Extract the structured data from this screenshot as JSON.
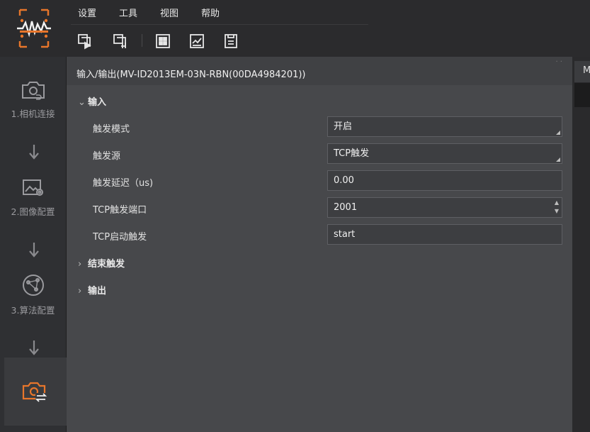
{
  "menu": [
    "设置",
    "工具",
    "视图",
    "帮助"
  ],
  "toolbar": {
    "icons": [
      "run-single-icon",
      "run-continuous-icon",
      "layout-grid-icon",
      "chart-icon",
      "save-icon"
    ]
  },
  "sidebar": {
    "steps": [
      {
        "label": "1.相机连接",
        "icon": "camera-link-icon"
      },
      {
        "label": "2.图像配置",
        "icon": "image-settings-icon"
      },
      {
        "label": "3.算法配置",
        "icon": "algorithm-icon"
      },
      {
        "label": "",
        "icon": "camera-io-icon"
      }
    ]
  },
  "panel": {
    "title": "输入/输出(MV-ID2013EM-03N-RBN(00DA4984201))",
    "groups": {
      "input": {
        "label": "输入",
        "expanded": true
      },
      "end_trigger": {
        "label": "结束触发",
        "expanded": false
      },
      "output": {
        "label": "输出",
        "expanded": false
      }
    },
    "properties": [
      {
        "label": "触发模式",
        "value": "开启",
        "type": "combo"
      },
      {
        "label": "触发源",
        "value": "TCP触发",
        "type": "combo"
      },
      {
        "label": "触发延迟（us)",
        "value": "0.00",
        "type": "text"
      },
      {
        "label": "TCP触发端口",
        "value": "2001",
        "type": "spinbox"
      },
      {
        "label": "TCP启动触发",
        "value": "start",
        "type": "text"
      }
    ]
  },
  "right_tab": {
    "label": "M"
  },
  "colors": {
    "accent": "#e8762b",
    "panel_bg": "#47484b",
    "sidebar_bg": "#2f3033"
  }
}
